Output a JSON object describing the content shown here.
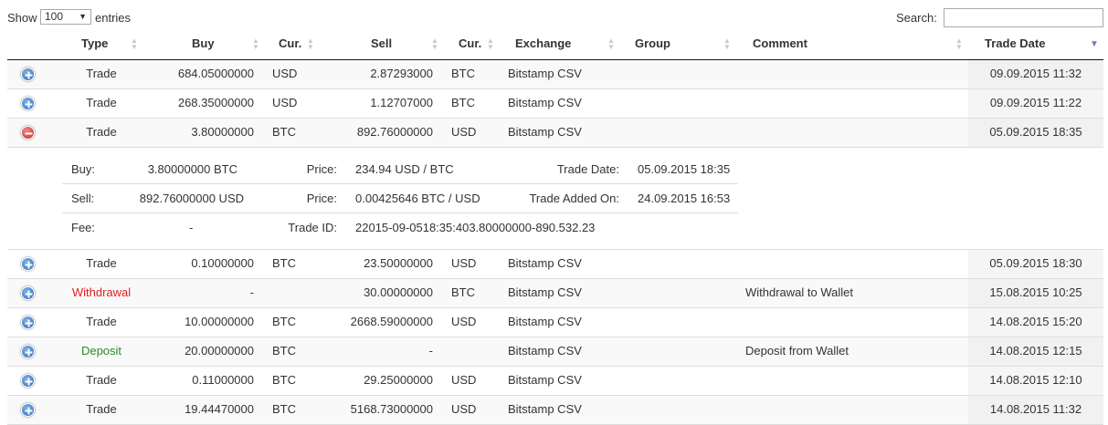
{
  "controls": {
    "show_label": "Show",
    "length_value": "100",
    "entries_label": "entries",
    "search_label": "Search:",
    "search_value": ""
  },
  "columns": [
    "Type",
    "Buy",
    "Cur.",
    "Sell",
    "Cur.",
    "Exchange",
    "Group",
    "Comment",
    "Trade Date"
  ],
  "sort": {
    "column": "Trade Date",
    "direction": "descending"
  },
  "rows": [
    {
      "expanded": false,
      "type": "Trade",
      "buy": "684.05000000",
      "buy_cur": "USD",
      "sell": "2.87293000",
      "sell_cur": "BTC",
      "exchange": "Bitstamp CSV",
      "group": "",
      "comment": "",
      "date": "09.09.2015 11:32"
    },
    {
      "expanded": false,
      "type": "Trade",
      "buy": "268.35000000",
      "buy_cur": "USD",
      "sell": "1.12707000",
      "sell_cur": "BTC",
      "exchange": "Bitstamp CSV",
      "group": "",
      "comment": "",
      "date": "09.09.2015 11:22"
    },
    {
      "expanded": true,
      "type": "Trade",
      "buy": "3.80000000",
      "buy_cur": "BTC",
      "sell": "892.76000000",
      "sell_cur": "USD",
      "exchange": "Bitstamp CSV",
      "group": "",
      "comment": "",
      "date": "05.09.2015 18:35"
    },
    {
      "expanded": false,
      "type": "Trade",
      "buy": "0.10000000",
      "buy_cur": "BTC",
      "sell": "23.50000000",
      "sell_cur": "USD",
      "exchange": "Bitstamp CSV",
      "group": "",
      "comment": "",
      "date": "05.09.2015 18:30"
    },
    {
      "expanded": false,
      "type": "Withdrawal",
      "buy": "-",
      "buy_cur": "",
      "sell": "30.00000000",
      "sell_cur": "BTC",
      "exchange": "Bitstamp CSV",
      "group": "",
      "comment": "Withdrawal to Wallet",
      "date": "15.08.2015 10:25"
    },
    {
      "expanded": false,
      "type": "Trade",
      "buy": "10.00000000",
      "buy_cur": "BTC",
      "sell": "2668.59000000",
      "sell_cur": "USD",
      "exchange": "Bitstamp CSV",
      "group": "",
      "comment": "",
      "date": "14.08.2015 15:20"
    },
    {
      "expanded": false,
      "type": "Deposit",
      "buy": "20.00000000",
      "buy_cur": "BTC",
      "sell": "-",
      "sell_cur": "",
      "exchange": "Bitstamp CSV",
      "group": "",
      "comment": "Deposit from Wallet",
      "date": "14.08.2015 12:15"
    },
    {
      "expanded": false,
      "type": "Trade",
      "buy": "0.11000000",
      "buy_cur": "BTC",
      "sell": "29.25000000",
      "sell_cur": "USD",
      "exchange": "Bitstamp CSV",
      "group": "",
      "comment": "",
      "date": "14.08.2015 12:10"
    },
    {
      "expanded": false,
      "type": "Trade",
      "buy": "19.44470000",
      "buy_cur": "BTC",
      "sell": "5168.73000000",
      "sell_cur": "USD",
      "exchange": "Bitstamp CSV",
      "group": "",
      "comment": "",
      "date": "14.08.2015 11:32"
    }
  ],
  "detail": {
    "buy_label": "Buy:",
    "buy_value": "3.80000000 BTC",
    "price1_label": "Price:",
    "price1_value": "234.94 USD / BTC",
    "trade_date_label": "Trade Date:",
    "trade_date_value": "05.09.2015 18:35",
    "sell_label": "Sell:",
    "sell_value": "892.76000000 USD",
    "price2_label": "Price:",
    "price2_value": "0.00425646 BTC / USD",
    "added_label": "Trade Added On:",
    "added_value": "24.09.2015 16:53",
    "fee_label": "Fee:",
    "fee_value": "-",
    "trade_id_label": "Trade ID:",
    "trade_id_value": "22015-09-0518:35:403.80000000-890.532.23"
  },
  "colors": {
    "withdrawal": "#e02020",
    "deposit": "#2a8a2a",
    "expand": "#2c6bb5",
    "collapse": "#c52a2a"
  },
  "icons": {
    "expand": "plus-circle-icon",
    "collapse": "minus-circle-icon",
    "sort": "sort-arrows-icon",
    "sort_desc": "sort-desc-icon",
    "select_caret": "chevron-down-icon"
  }
}
